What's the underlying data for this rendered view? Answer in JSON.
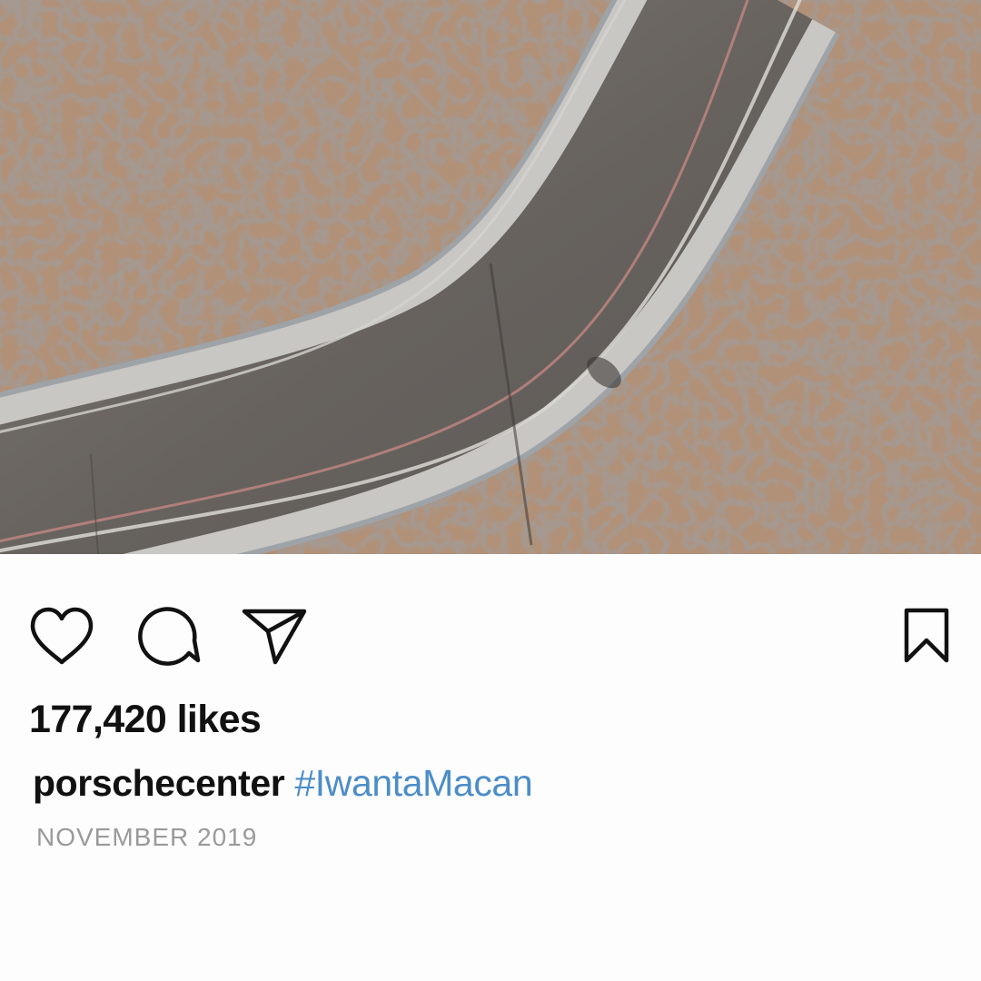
{
  "post": {
    "image_alt": "",
    "likes_text": "177,420 likes",
    "username": "porschecenter",
    "hashtag": "#IwantaMacan",
    "date": "NOVEMBER 2019"
  },
  "actions": {
    "like_icon": "heart-icon",
    "comment_icon": "speech-bubble-icon",
    "share_icon": "paper-plane-icon",
    "save_icon": "bookmark-icon"
  },
  "colors": {
    "background": "#fdfdfd",
    "text": "#111111",
    "hashtag": "#4c8dc8",
    "muted": "#9a9a9a",
    "ground": "#b49277",
    "asphalt": "#6f6a66"
  }
}
